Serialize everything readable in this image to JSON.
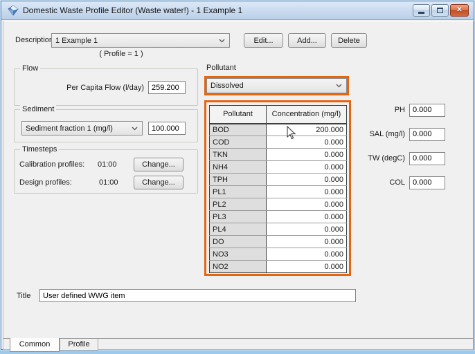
{
  "window": {
    "title": "Domestic Waste Profile Editor (Waste water!) - 1 Example 1"
  },
  "description": {
    "label": "Description",
    "value": "1 Example 1",
    "note": "( Profile = 1 )",
    "edit_label": "Edit...",
    "add_label": "Add...",
    "delete_label": "Delete"
  },
  "flow": {
    "legend": "Flow",
    "per_capita_label": "Per Capita Flow (l/day)",
    "per_capita_value": "259.200"
  },
  "sediment": {
    "legend": "Sediment",
    "fraction_selected": "Sediment fraction 1 (mg/l)",
    "fraction_value": "100.000"
  },
  "timesteps": {
    "legend": "Timesteps",
    "calibration_label": "Calibration profiles:",
    "calibration_value": "01:00",
    "design_label": "Design profiles:",
    "design_value": "01:00",
    "change_label": "Change..."
  },
  "pollutant": {
    "section_label": "Pollutant",
    "phase_selected": "Dissolved",
    "table": {
      "headers": [
        "Pollutant",
        "Concentration (mg/l)"
      ],
      "rows": [
        {
          "name": "BOD",
          "concentration": "200.000"
        },
        {
          "name": "COD",
          "concentration": "0.000"
        },
        {
          "name": "TKN",
          "concentration": "0.000"
        },
        {
          "name": "NH4",
          "concentration": "0.000"
        },
        {
          "name": "TPH",
          "concentration": "0.000"
        },
        {
          "name": "PL1",
          "concentration": "0.000"
        },
        {
          "name": "PL2",
          "concentration": "0.000"
        },
        {
          "name": "PL3",
          "concentration": "0.000"
        },
        {
          "name": "PL4",
          "concentration": "0.000"
        },
        {
          "name": "DO",
          "concentration": "0.000"
        },
        {
          "name": "NO3",
          "concentration": "0.000"
        },
        {
          "name": "NO2",
          "concentration": "0.000"
        }
      ]
    }
  },
  "scalar_fields": [
    {
      "label": "PH",
      "value": "0.000"
    },
    {
      "label": "SAL (mg/l)",
      "value": "0.000"
    },
    {
      "label": "TW (degC)",
      "value": "0.000"
    },
    {
      "label": "COL",
      "value": "0.000"
    }
  ],
  "title_field": {
    "label": "Title",
    "value": "User defined WWG item"
  },
  "tabs": [
    {
      "label": "Common",
      "active": true
    },
    {
      "label": "Profile",
      "active": false
    }
  ],
  "colors": {
    "highlight": "#e8650f",
    "titlebar_top": "#dce9f7",
    "titlebar_bottom": "#b9cfe8",
    "close_button": "#c34f27"
  }
}
